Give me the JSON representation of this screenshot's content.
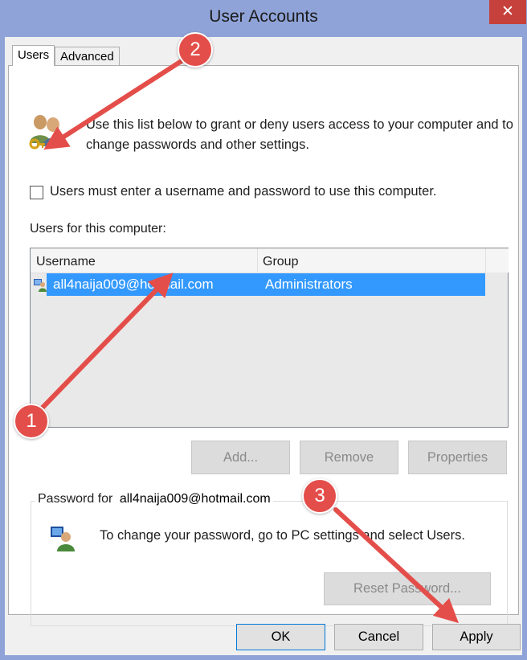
{
  "window": {
    "title": "User Accounts",
    "close_symbol": "✕",
    "titlebar_color": "#8fa3d8",
    "close_color": "#c6413c"
  },
  "tabs": [
    {
      "label": "Users",
      "selected": true
    },
    {
      "label": "Advanced",
      "selected": false
    }
  ],
  "users_tab": {
    "intro_text": "Use this list below to grant or deny users access to your computer and to change passwords and other settings.",
    "intro_icon": "users-keys-icon",
    "require_login_checkbox": {
      "label": "Users must enter a username and password to use this computer.",
      "checked": false
    },
    "users_label": "Users for this computer:",
    "table": {
      "columns": [
        "Username",
        "Group"
      ],
      "rows": [
        {
          "username": "all4naija009@hotmail.com",
          "group": "Administrators",
          "selected": true,
          "icon": "user-account-icon"
        }
      ],
      "selection_color": "#3399ff"
    },
    "buttons": {
      "add": "Add...",
      "remove": "Remove",
      "properties": "Properties"
    },
    "password_group": {
      "legend": "Password for",
      "user": "all4naija009@hotmail.com",
      "icon": "user-password-icon",
      "text": "To change your password, go to PC settings and select Users.",
      "reset_button": "Reset Password..."
    }
  },
  "footer_buttons": {
    "ok": "OK",
    "cancel": "Cancel",
    "apply": "Apply"
  },
  "annotations": {
    "color": "#e44e4a",
    "badges": [
      "1",
      "2",
      "3"
    ]
  }
}
